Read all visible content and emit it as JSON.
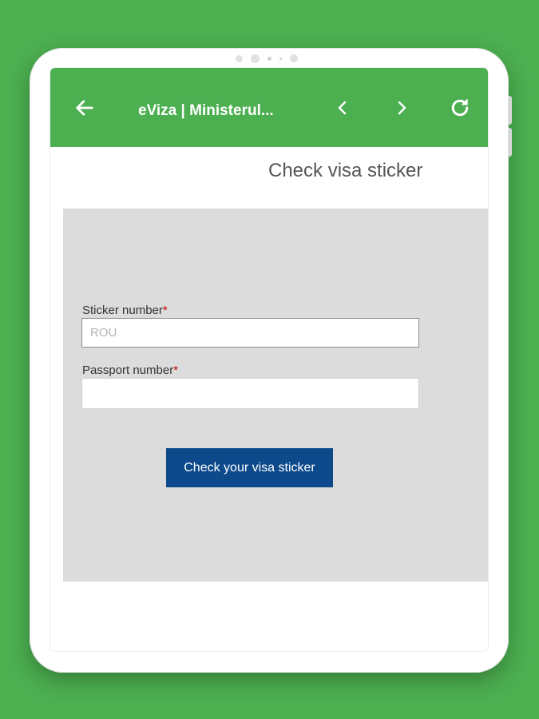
{
  "toolbar": {
    "title": "eViza | Ministerul...",
    "icons": {
      "back": "arrow-left-icon",
      "prev": "chevron-left-icon",
      "next": "chevron-right-icon",
      "reload": "refresh-icon"
    },
    "background_color": "#4caf50"
  },
  "page": {
    "heading": "Check visa sticker"
  },
  "form": {
    "sticker_label": "Sticker number",
    "sticker_required_mark": "*",
    "sticker_placeholder": "ROU",
    "sticker_value": "",
    "passport_label": "Passport number",
    "passport_required_mark": "*",
    "passport_placeholder": "",
    "passport_value": "",
    "submit_label": "Check your visa sticker",
    "panel_color": "#dcdcdc",
    "button_color": "#0d4a8c",
    "required_color": "#cc0000"
  }
}
